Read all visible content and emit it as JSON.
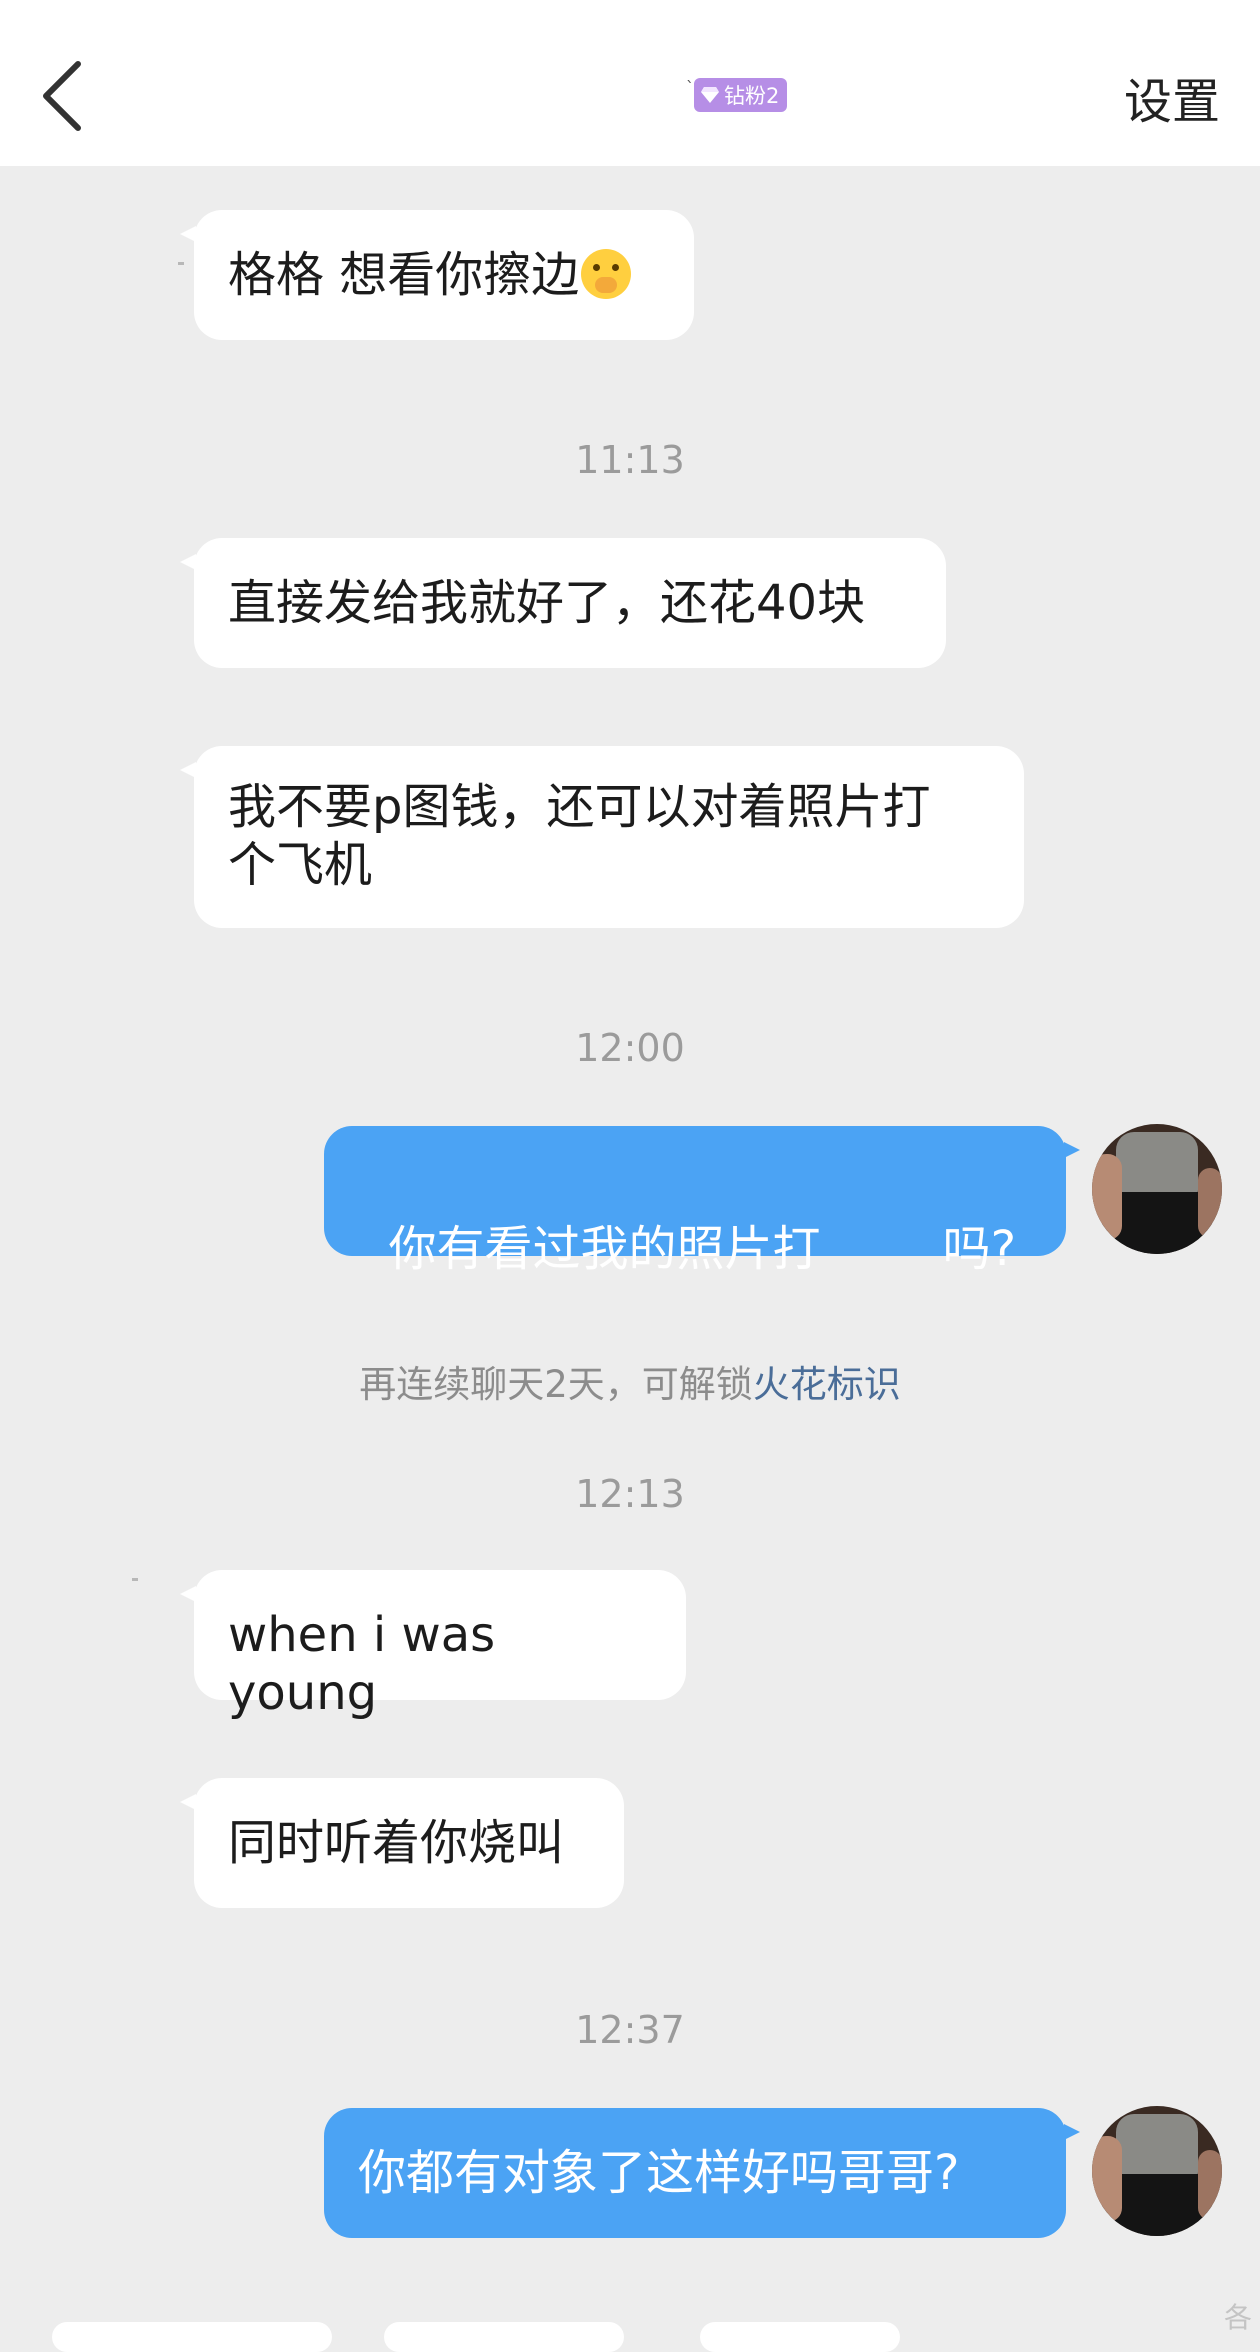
{
  "header": {
    "badge_label": "钻粉2",
    "settings_label": "设置"
  },
  "messages": [
    {
      "text": "格格 想看你擦边"
    },
    {
      "time": "11:13"
    },
    {
      "text": "直接发给我就好了，还花40块"
    },
    {
      "text_line1": "我不要p图钱，还可以对着照片打",
      "text_line2": "个飞机"
    },
    {
      "time": "12:00"
    },
    {
      "text": "你有看过我的照片打        吗?"
    },
    {
      "notice_prefix": "再连续聊天2天，可解锁",
      "notice_link": "火花标识"
    },
    {
      "time": "12:13"
    },
    {
      "text": "when i was young"
    },
    {
      "text": "同时听着你烧叫"
    },
    {
      "time": "12:37"
    },
    {
      "text": "你都有对象了这样好吗哥哥?"
    }
  ],
  "watermark": "各",
  "colors": {
    "background": "#ededed",
    "outgoing_bubble": "#4ba3f4",
    "incoming_bubble": "#ffffff",
    "badge": "#b68ee6",
    "notice_link": "#4a6d98"
  }
}
